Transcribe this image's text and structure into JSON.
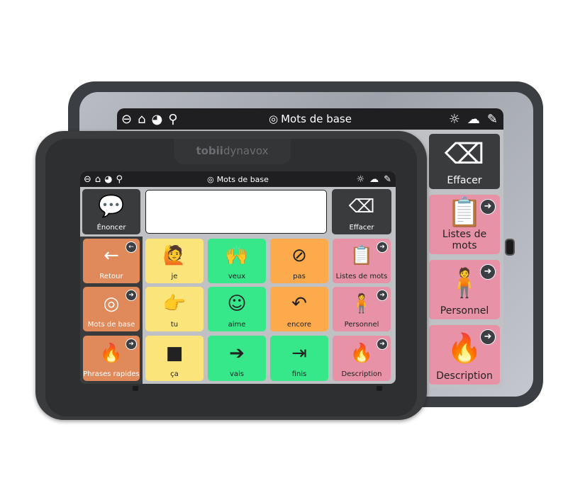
{
  "brand": {
    "bold": "tobii",
    "light": "dynavox"
  },
  "screen": {
    "title": "Mots de base",
    "title_icon": "target-icon",
    "toolbar_left": [
      {
        "name": "back-icon",
        "glyph": "⊖"
      },
      {
        "name": "home-icon",
        "glyph": "⌂"
      },
      {
        "name": "dashboard-icon",
        "glyph": "◕"
      },
      {
        "name": "search-icon",
        "glyph": "⚲"
      }
    ],
    "toolbar_right": [
      {
        "name": "brightness-icon",
        "glyph": "☼"
      },
      {
        "name": "sync-cloud-icon",
        "glyph": "☁"
      },
      {
        "name": "edit-settings-icon",
        "glyph": "✎"
      }
    ]
  },
  "message_bar": {
    "speak_label": "Énoncer",
    "clear_label": "Effacer",
    "message_text": ""
  },
  "grid": {
    "rows": [
      [
        {
          "label": "Retour",
          "color": "orange-nav",
          "symbol": "←",
          "nav": "left"
        },
        {
          "label": "je",
          "color": "yellow",
          "symbol": "🙋"
        },
        {
          "label": "veux",
          "color": "green",
          "symbol": "🙌"
        },
        {
          "label": "pas",
          "color": "orange",
          "symbol": "⊘"
        },
        {
          "label": "Listes de mots",
          "color": "pink",
          "symbol": "📋",
          "nav": "right"
        }
      ],
      [
        {
          "label": "Mots de base",
          "color": "orange-nav",
          "symbol": "◎",
          "nav": "right"
        },
        {
          "label": "tu",
          "color": "yellow",
          "symbol": "👉"
        },
        {
          "label": "aime",
          "color": "green",
          "symbol": "☺"
        },
        {
          "label": "encore",
          "color": "orange",
          "symbol": "↶"
        },
        {
          "label": "Personnel",
          "color": "pink",
          "symbol": "🧍",
          "nav": "right"
        }
      ],
      [
        {
          "label": "Phrases rapides",
          "color": "orange-nav",
          "symbol": "🔥",
          "nav": "right"
        },
        {
          "label": "ça",
          "color": "yellow",
          "symbol": "■"
        },
        {
          "label": "vais",
          "color": "green",
          "symbol": "➔"
        },
        {
          "label": "finis",
          "color": "green",
          "symbol": "⇥"
        },
        {
          "label": "Description",
          "color": "pink",
          "symbol": "🔥",
          "nav": "right"
        }
      ]
    ]
  }
}
